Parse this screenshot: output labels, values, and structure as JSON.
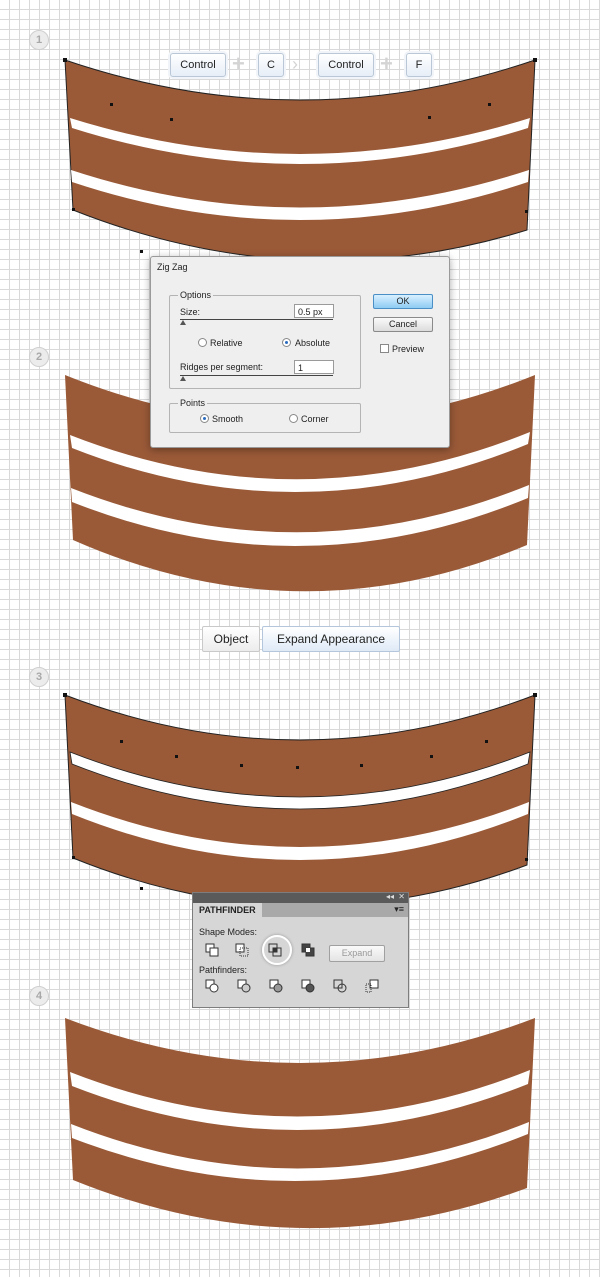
{
  "colors": {
    "cake_fill": "#9a5a38",
    "stripe": "#ffffff",
    "grid": "#d9d9d9"
  },
  "steps": [
    "1",
    "2",
    "3",
    "4"
  ],
  "shortcut_keys": {
    "key1": "Control",
    "key2": "C",
    "key3": "Control",
    "key4": "F"
  },
  "menu_path": {
    "item1": "Object",
    "item2": "Expand Appearance"
  },
  "zigzag_dialog": {
    "title": "Zig Zag",
    "options_label": "Options",
    "size_label": "Size:",
    "size_value": "0.5 px",
    "relative_label": "Relative",
    "absolute_label": "Absolute",
    "ridges_label": "Ridges per segment:",
    "ridges_value": "1",
    "points_label": "Points",
    "smooth_label": "Smooth",
    "corner_label": "Corner",
    "ok_label": "OK",
    "cancel_label": "Cancel",
    "preview_label": "Preview",
    "selected_mode": "Absolute",
    "selected_points": "Smooth"
  },
  "pathfinder": {
    "tab_label": "PATHFINDER",
    "shape_modes_label": "Shape Modes:",
    "pathfinders_label": "Pathfinders:",
    "expand_label": "Expand",
    "collapse_icon": "double-chevron-left-icon",
    "close_icon": "close-icon",
    "menu_icon": "panel-menu-icon"
  }
}
